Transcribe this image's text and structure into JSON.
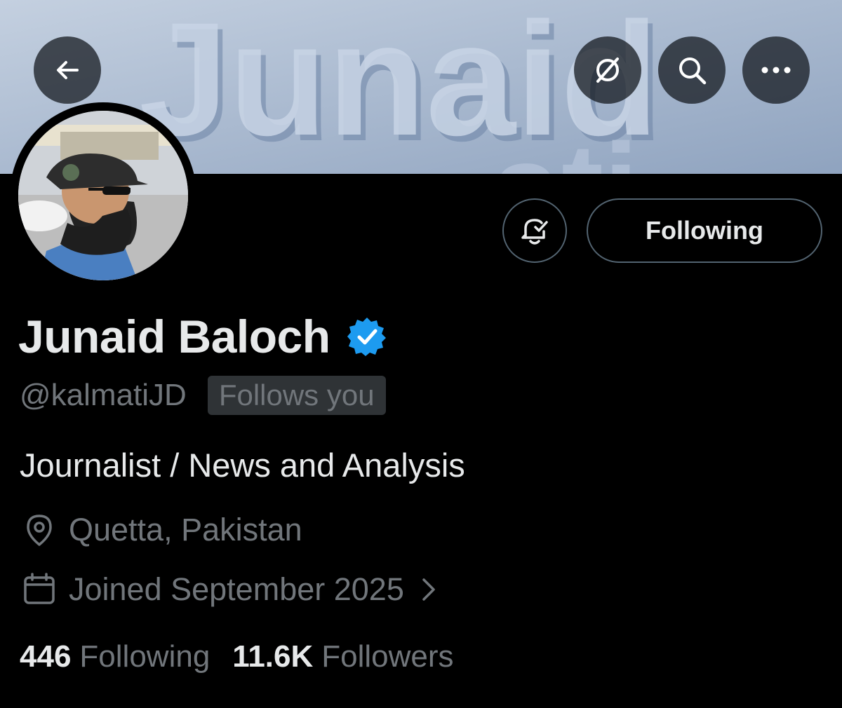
{
  "profile": {
    "name": "Junaid Baloch",
    "handle": "@kalmatiJD",
    "follows_you": "Follows you",
    "bio": "Journalist / News and Analysis",
    "location": "Quetta, Pakistan",
    "joined": "Joined September 2025",
    "following_count": "446",
    "following_label": "Following",
    "followers_count": "11.6K",
    "followers_label": "Followers",
    "verified": true
  },
  "banner": {
    "text": "Junaid Kalmati"
  },
  "actions": {
    "following_button": "Following"
  },
  "icons": {
    "back": "back-arrow-icon",
    "grok": "grok-icon",
    "search": "search-icon",
    "more": "more-icon",
    "bell": "bell-check-icon",
    "verified": "verified-badge-icon",
    "location": "location-pin-icon",
    "calendar": "calendar-icon",
    "chevron": "chevron-right-icon"
  },
  "colors": {
    "background": "#000000",
    "primary_text": "#e7e9ea",
    "secondary_text": "#71767b",
    "verified_blue": "#1d9bf0",
    "border": "#536471"
  }
}
